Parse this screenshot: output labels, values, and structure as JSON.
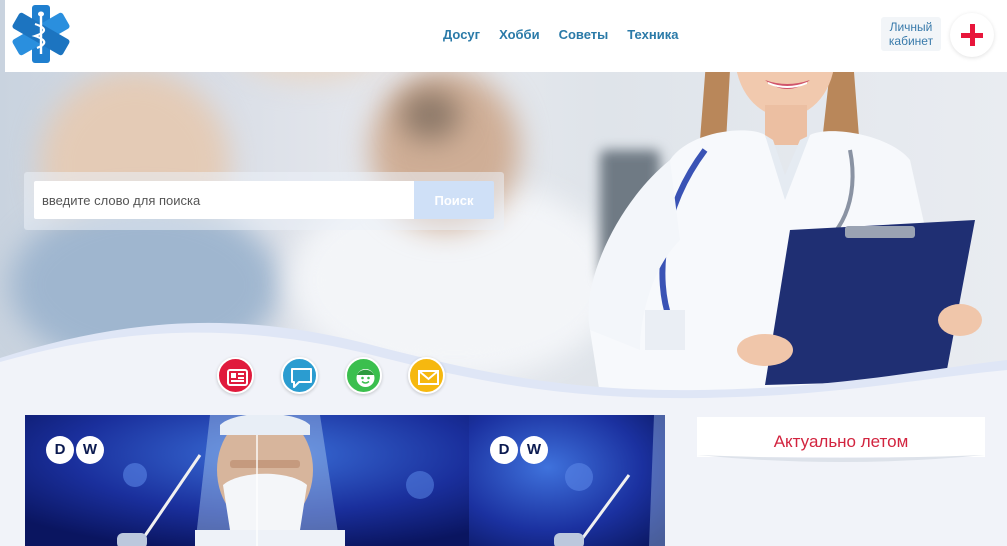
{
  "header": {
    "nav": [
      "Досуг",
      "Хобби",
      "Советы",
      "Техника"
    ],
    "cabinet_line1": "Личный",
    "cabinet_line2": "кабинет"
  },
  "search": {
    "placeholder": "введите слово для поиска",
    "button_label": "Поиск"
  },
  "quick_icons": [
    "news-icon",
    "chat-icon",
    "face-icon",
    "mail-icon"
  ],
  "news": {
    "tile1_logo": [
      "D",
      "W"
    ],
    "tile2_logo": [
      "D",
      "W"
    ]
  },
  "sidebar": {
    "title": "Актуально летом"
  },
  "colors": {
    "accent_red": "#e8163b",
    "nav_blue": "#2a7aa8",
    "search_button": "#cfe0f7"
  }
}
